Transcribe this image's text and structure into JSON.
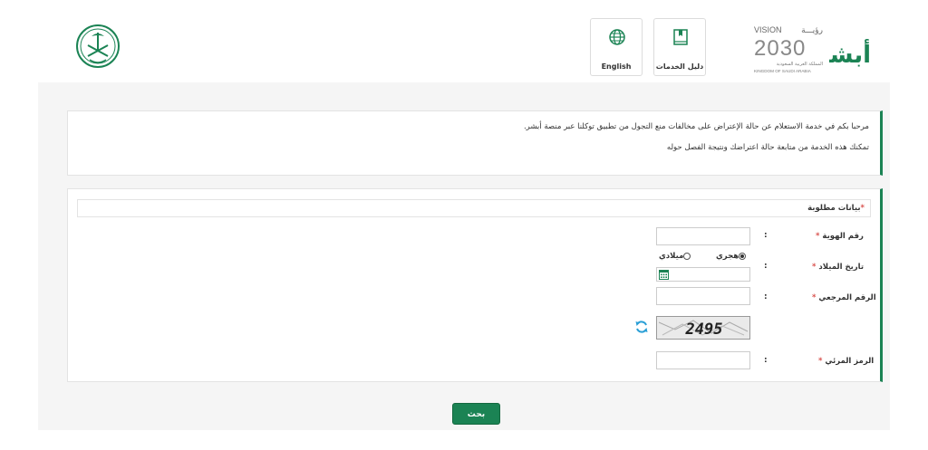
{
  "header": {
    "english_label": "English",
    "guide_label": "دليل الخدمات",
    "vision": {
      "word": "VISION",
      "arabic_word": "رؤيـــة",
      "year": "2030",
      "kingdom_ar": "المملكة العربية السعودية",
      "kingdom_en": "KINGDOM OF SAUDI ARABIA"
    },
    "absher_logo": "أبشر",
    "icons": {
      "english": "globe-icon",
      "guide": "book-icon",
      "emblem": "saudi-emblem-logo",
      "absher": "absher-logo"
    }
  },
  "info": {
    "line1": "مرحبا بكم في خدمة الاستعلام عن حالة الإعتراض على مخالفات منع التجول من تطبيق توكلنا عبر منصة أبشر.",
    "line2": "تمكنك هذه الخدمة من متابعة حالة اعتراضك ونتيجة الفصل حوله"
  },
  "form": {
    "section_title": "بيانات مطلوبة",
    "required_mark": "*",
    "colon": ":",
    "id_label": "رقم الهوية",
    "birthdate_label": "تاريخ الميلاد",
    "hijri_label": "هجري",
    "gregorian_label": "ميلادي",
    "reference_label": "الرقم المرجعي",
    "captcha_label": "الرمز المرئي",
    "captcha_text": "2495",
    "selected_calendar": "هجري"
  },
  "actions": {
    "search_label": "بحث"
  },
  "colors": {
    "primary_green": "#1b8354",
    "required_red": "#d9534f",
    "panel_bg": "#f5f5f5"
  }
}
